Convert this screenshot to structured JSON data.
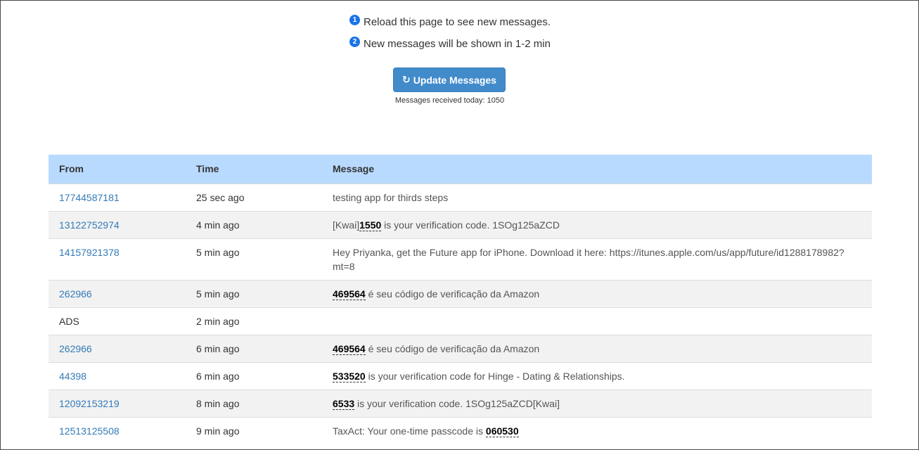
{
  "notes": [
    {
      "num": "1",
      "text": "Reload this page to see new messages."
    },
    {
      "num": "2",
      "text": "New messages will be shown in 1-2 min"
    }
  ],
  "update_button": {
    "icon": "↻",
    "label": "Update Messages"
  },
  "count_text": "Messages received today: 1050",
  "table": {
    "headers": [
      "From",
      "Time",
      "Message"
    ],
    "rows": [
      {
        "from": "17744587181",
        "link": true,
        "time": "25 sec ago",
        "parts": [
          {
            "t": "testing app for thirds steps"
          }
        ]
      },
      {
        "from": "13122752974",
        "link": true,
        "time": "4 min ago",
        "parts": [
          {
            "t": "[Kwai]"
          },
          {
            "t": "1550",
            "code": true
          },
          {
            "t": " is your verification code. 1SOg125aZCD"
          }
        ]
      },
      {
        "from": "14157921378",
        "link": true,
        "time": "5 min ago",
        "parts": [
          {
            "t": "Hey Priyanka, get the Future app for iPhone. Download it here: https://itunes.apple.com/us/app/future/id1288178982?mt=8"
          }
        ]
      },
      {
        "from": "262966",
        "link": true,
        "time": "5 min ago",
        "parts": [
          {
            "t": "469564",
            "code": true
          },
          {
            "t": " é seu código de verificação da Amazon"
          }
        ]
      },
      {
        "from": "ADS",
        "link": false,
        "time": "2 min ago",
        "parts": []
      },
      {
        "from": "262966",
        "link": true,
        "time": "6 min ago",
        "parts": [
          {
            "t": "469564",
            "code": true
          },
          {
            "t": " é seu código de verificação da Amazon"
          }
        ]
      },
      {
        "from": "44398",
        "link": true,
        "time": "6 min ago",
        "parts": [
          {
            "t": "533520",
            "code": true
          },
          {
            "t": " is your verification code for Hinge - Dating & Relationships."
          }
        ]
      },
      {
        "from": "12092153219",
        "link": true,
        "time": "8 min ago",
        "parts": [
          {
            "t": "6533",
            "code": true
          },
          {
            "t": " is your verification code. 1SOg125aZCD[Kwai]"
          }
        ]
      },
      {
        "from": "12513125508",
        "link": true,
        "time": "9 min ago",
        "parts": [
          {
            "t": "TaxAct: Your one-time passcode is "
          },
          {
            "t": "060530",
            "code": true
          }
        ]
      }
    ]
  }
}
